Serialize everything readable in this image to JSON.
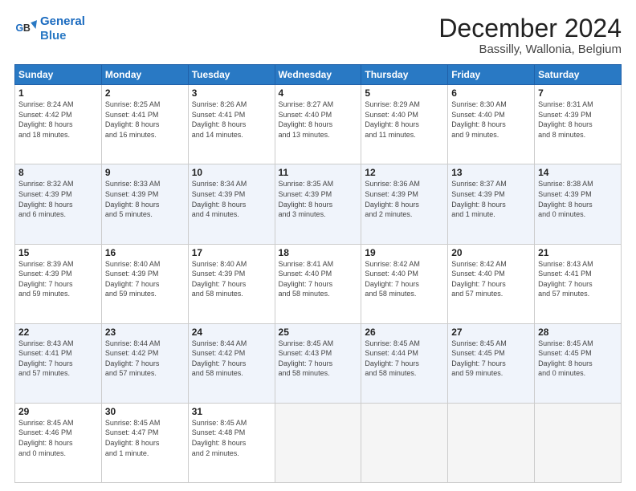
{
  "logo": {
    "line1": "General",
    "line2": "Blue"
  },
  "header": {
    "month": "December 2024",
    "location": "Bassilly, Wallonia, Belgium"
  },
  "weekdays": [
    "Sunday",
    "Monday",
    "Tuesday",
    "Wednesday",
    "Thursday",
    "Friday",
    "Saturday"
  ],
  "weeks": [
    [
      {
        "day": "1",
        "info": "Sunrise: 8:24 AM\nSunset: 4:42 PM\nDaylight: 8 hours\nand 18 minutes."
      },
      {
        "day": "2",
        "info": "Sunrise: 8:25 AM\nSunset: 4:41 PM\nDaylight: 8 hours\nand 16 minutes."
      },
      {
        "day": "3",
        "info": "Sunrise: 8:26 AM\nSunset: 4:41 PM\nDaylight: 8 hours\nand 14 minutes."
      },
      {
        "day": "4",
        "info": "Sunrise: 8:27 AM\nSunset: 4:40 PM\nDaylight: 8 hours\nand 13 minutes."
      },
      {
        "day": "5",
        "info": "Sunrise: 8:29 AM\nSunset: 4:40 PM\nDaylight: 8 hours\nand 11 minutes."
      },
      {
        "day": "6",
        "info": "Sunrise: 8:30 AM\nSunset: 4:40 PM\nDaylight: 8 hours\nand 9 minutes."
      },
      {
        "day": "7",
        "info": "Sunrise: 8:31 AM\nSunset: 4:39 PM\nDaylight: 8 hours\nand 8 minutes."
      }
    ],
    [
      {
        "day": "8",
        "info": "Sunrise: 8:32 AM\nSunset: 4:39 PM\nDaylight: 8 hours\nand 6 minutes."
      },
      {
        "day": "9",
        "info": "Sunrise: 8:33 AM\nSunset: 4:39 PM\nDaylight: 8 hours\nand 5 minutes."
      },
      {
        "day": "10",
        "info": "Sunrise: 8:34 AM\nSunset: 4:39 PM\nDaylight: 8 hours\nand 4 minutes."
      },
      {
        "day": "11",
        "info": "Sunrise: 8:35 AM\nSunset: 4:39 PM\nDaylight: 8 hours\nand 3 minutes."
      },
      {
        "day": "12",
        "info": "Sunrise: 8:36 AM\nSunset: 4:39 PM\nDaylight: 8 hours\nand 2 minutes."
      },
      {
        "day": "13",
        "info": "Sunrise: 8:37 AM\nSunset: 4:39 PM\nDaylight: 8 hours\nand 1 minute."
      },
      {
        "day": "14",
        "info": "Sunrise: 8:38 AM\nSunset: 4:39 PM\nDaylight: 8 hours\nand 0 minutes."
      }
    ],
    [
      {
        "day": "15",
        "info": "Sunrise: 8:39 AM\nSunset: 4:39 PM\nDaylight: 7 hours\nand 59 minutes."
      },
      {
        "day": "16",
        "info": "Sunrise: 8:40 AM\nSunset: 4:39 PM\nDaylight: 7 hours\nand 59 minutes."
      },
      {
        "day": "17",
        "info": "Sunrise: 8:40 AM\nSunset: 4:39 PM\nDaylight: 7 hours\nand 58 minutes."
      },
      {
        "day": "18",
        "info": "Sunrise: 8:41 AM\nSunset: 4:40 PM\nDaylight: 7 hours\nand 58 minutes."
      },
      {
        "day": "19",
        "info": "Sunrise: 8:42 AM\nSunset: 4:40 PM\nDaylight: 7 hours\nand 58 minutes."
      },
      {
        "day": "20",
        "info": "Sunrise: 8:42 AM\nSunset: 4:40 PM\nDaylight: 7 hours\nand 57 minutes."
      },
      {
        "day": "21",
        "info": "Sunrise: 8:43 AM\nSunset: 4:41 PM\nDaylight: 7 hours\nand 57 minutes."
      }
    ],
    [
      {
        "day": "22",
        "info": "Sunrise: 8:43 AM\nSunset: 4:41 PM\nDaylight: 7 hours\nand 57 minutes."
      },
      {
        "day": "23",
        "info": "Sunrise: 8:44 AM\nSunset: 4:42 PM\nDaylight: 7 hours\nand 57 minutes."
      },
      {
        "day": "24",
        "info": "Sunrise: 8:44 AM\nSunset: 4:42 PM\nDaylight: 7 hours\nand 58 minutes."
      },
      {
        "day": "25",
        "info": "Sunrise: 8:45 AM\nSunset: 4:43 PM\nDaylight: 7 hours\nand 58 minutes."
      },
      {
        "day": "26",
        "info": "Sunrise: 8:45 AM\nSunset: 4:44 PM\nDaylight: 7 hours\nand 58 minutes."
      },
      {
        "day": "27",
        "info": "Sunrise: 8:45 AM\nSunset: 4:45 PM\nDaylight: 7 hours\nand 59 minutes."
      },
      {
        "day": "28",
        "info": "Sunrise: 8:45 AM\nSunset: 4:45 PM\nDaylight: 8 hours\nand 0 minutes."
      }
    ],
    [
      {
        "day": "29",
        "info": "Sunrise: 8:45 AM\nSunset: 4:46 PM\nDaylight: 8 hours\nand 0 minutes."
      },
      {
        "day": "30",
        "info": "Sunrise: 8:45 AM\nSunset: 4:47 PM\nDaylight: 8 hours\nand 1 minute."
      },
      {
        "day": "31",
        "info": "Sunrise: 8:45 AM\nSunset: 4:48 PM\nDaylight: 8 hours\nand 2 minutes."
      },
      null,
      null,
      null,
      null
    ]
  ]
}
